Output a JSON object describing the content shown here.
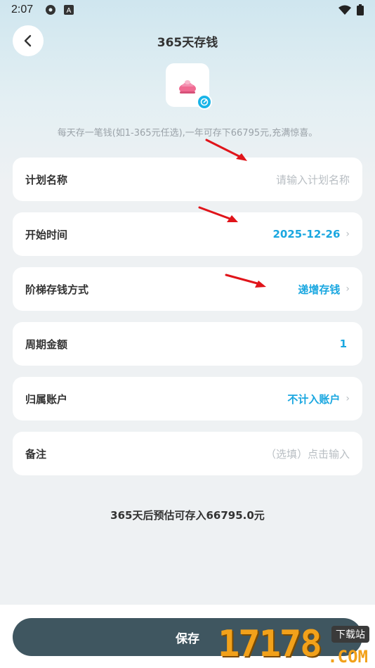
{
  "status_bar": {
    "time": "2:07"
  },
  "header": {
    "title": "365天存钱"
  },
  "hint": "每天存一笔钱(如1-365元任选),一年可存下66795元,充满惊喜。",
  "form": {
    "plan_name": {
      "label": "计划名称",
      "placeholder": "请输入计划名称"
    },
    "start_time": {
      "label": "开始时间",
      "value": "2025-12-26"
    },
    "ladder_mode": {
      "label": "阶梯存钱方式",
      "value": "递增存钱"
    },
    "period_amount": {
      "label": "周期金额",
      "value": "1"
    },
    "account": {
      "label": "归属账户",
      "value": "不计入账户"
    },
    "note": {
      "label": "备注",
      "placeholder": "（选填）点击输入"
    }
  },
  "estimate": "365天后预估可存入66795.0元",
  "save_label": "保存",
  "watermark": {
    "digits": "17178",
    "tag": "下载站",
    "com": ".COM"
  },
  "colors": {
    "accent": "#1aa7e0",
    "save_button": "#3f5660",
    "arrow": "#e0141a"
  }
}
